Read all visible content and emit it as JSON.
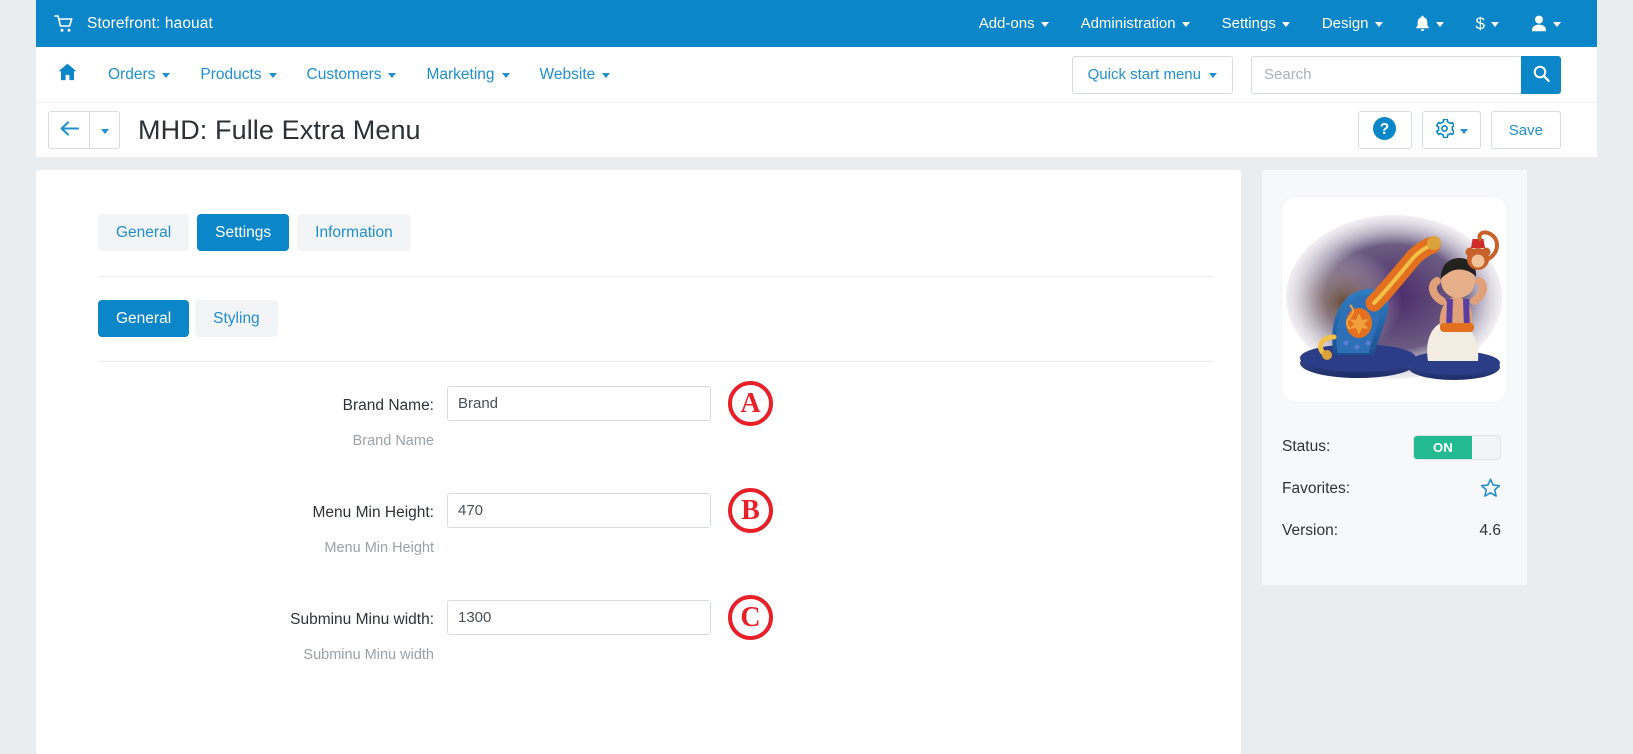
{
  "topbar": {
    "store_icon": "cart-icon",
    "store_label": "Storefront: haouat",
    "menus": [
      {
        "label": "Add-ons",
        "has_caret": true
      },
      {
        "label": "Administration",
        "has_caret": true
      },
      {
        "label": "Settings",
        "has_caret": true
      },
      {
        "label": "Design",
        "has_caret": true
      }
    ],
    "icons": [
      {
        "name": "bell-icon",
        "glyph": "ὑ4",
        "has_caret": true
      },
      {
        "name": "currency-icon",
        "glyph": "$",
        "has_caret": true
      },
      {
        "name": "user-icon",
        "glyph": "user",
        "has_caret": true
      }
    ]
  },
  "nav": {
    "home_icon": "home-icon",
    "items": [
      {
        "label": "Orders"
      },
      {
        "label": "Products"
      },
      {
        "label": "Customers"
      },
      {
        "label": "Marketing"
      },
      {
        "label": "Website"
      }
    ],
    "quick_start_label": "Quick start menu",
    "search_placeholder": "Search",
    "search_value": "",
    "search_button_icon": "search-icon"
  },
  "title_row": {
    "back_icon": "arrow-left-icon",
    "back_caret_icon": "chevron-down-icon",
    "title": "MHD: Fulle Extra Menu",
    "help_icon": "help-circle-icon",
    "gear_icon": "gear-icon",
    "save_label": "Save"
  },
  "main": {
    "tabs": [
      {
        "label": "General",
        "active": false
      },
      {
        "label": "Settings",
        "active": true
      },
      {
        "label": "Information",
        "active": false
      }
    ],
    "subtabs": [
      {
        "label": "General",
        "active": true
      },
      {
        "label": "Styling",
        "active": false
      }
    ],
    "fields": [
      {
        "label": "Brand Name:",
        "value": "Brand",
        "hint": "Brand Name",
        "marker": "A"
      },
      {
        "label": "Menu Min Height:",
        "value": "470",
        "hint": "Menu Min Height",
        "marker": "B"
      },
      {
        "label": "Subminu Minu width:",
        "value": "1300",
        "hint": "Subminu Minu width",
        "marker": "C"
      }
    ]
  },
  "sidebar": {
    "thumbnail_name": "addon-thumbnail-aladdin-lamp",
    "status_label": "Status:",
    "status_toggle_text": "ON",
    "favorites_label": "Favorites:",
    "favorites_icon": "star-outline-icon",
    "version_label": "Version:",
    "version_value": "4.6"
  },
  "colors": {
    "brand_blue": "#0b86c8",
    "link_blue": "#1f8fcd",
    "toggle_green": "#24bb93",
    "marker_red": "#e8202a",
    "page_bg": "#e9edef"
  }
}
